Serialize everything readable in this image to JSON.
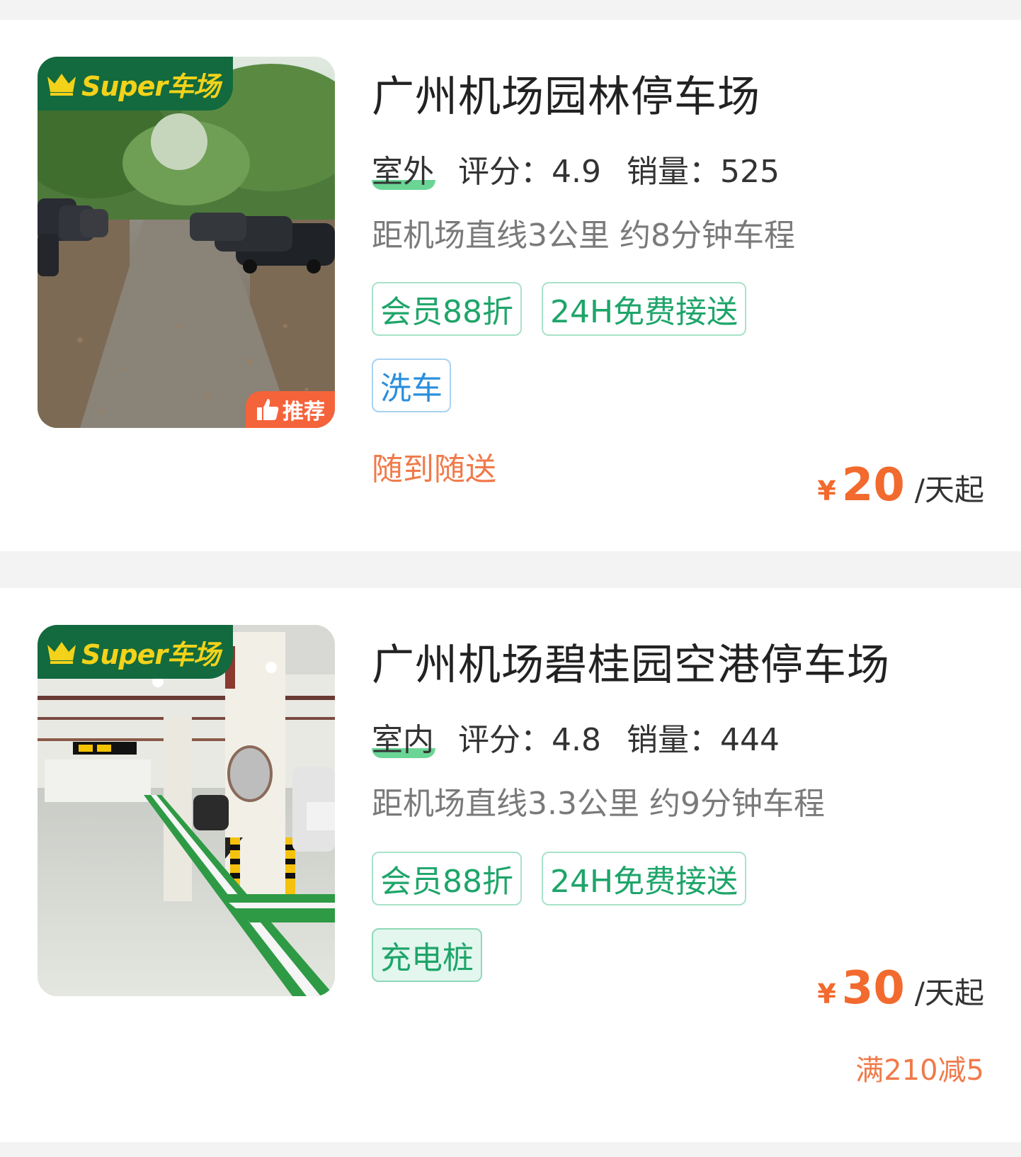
{
  "listings": [
    {
      "title": "广州机场园林停车场",
      "env": "室外",
      "rating_label": "评分：",
      "rating": "4.9",
      "sales_label": "销量：",
      "sales": "525",
      "distance": "距机场直线3公里 约8分钟车程",
      "tags_row1": [
        "会员88折",
        "24H免费接送"
      ],
      "tags_row2": [
        "洗车"
      ],
      "note": "随到随送",
      "badge": "Super车场",
      "recommend": "推荐",
      "currency": "¥",
      "price": "20",
      "price_unit": "/天起",
      "discount": ""
    },
    {
      "title": "广州机场碧桂园空港停车场",
      "env": "室内",
      "rating_label": "评分：",
      "rating": "4.8",
      "sales_label": "销量：",
      "sales": "444",
      "distance": "距机场直线3.3公里 约9分钟车程",
      "tags_row1": [
        "会员88折",
        "24H免费接送"
      ],
      "tags_row2": [
        "充电桩"
      ],
      "note": "",
      "badge": "Super车场",
      "recommend": "",
      "currency": "¥",
      "price": "30",
      "price_unit": "/天起",
      "discount": "满210减5"
    }
  ],
  "colors": {
    "brand_green": "#126a3e",
    "badge_gold": "#f3d21a",
    "price_orange": "#f26a2e",
    "tag_green": "#1ea56a",
    "tag_blue": "#2a8fdc",
    "recommend_orange": "#f5633b"
  },
  "icons": {
    "badge_icon": "crown-icon",
    "recommend_icon": "thumb-up-icon"
  }
}
